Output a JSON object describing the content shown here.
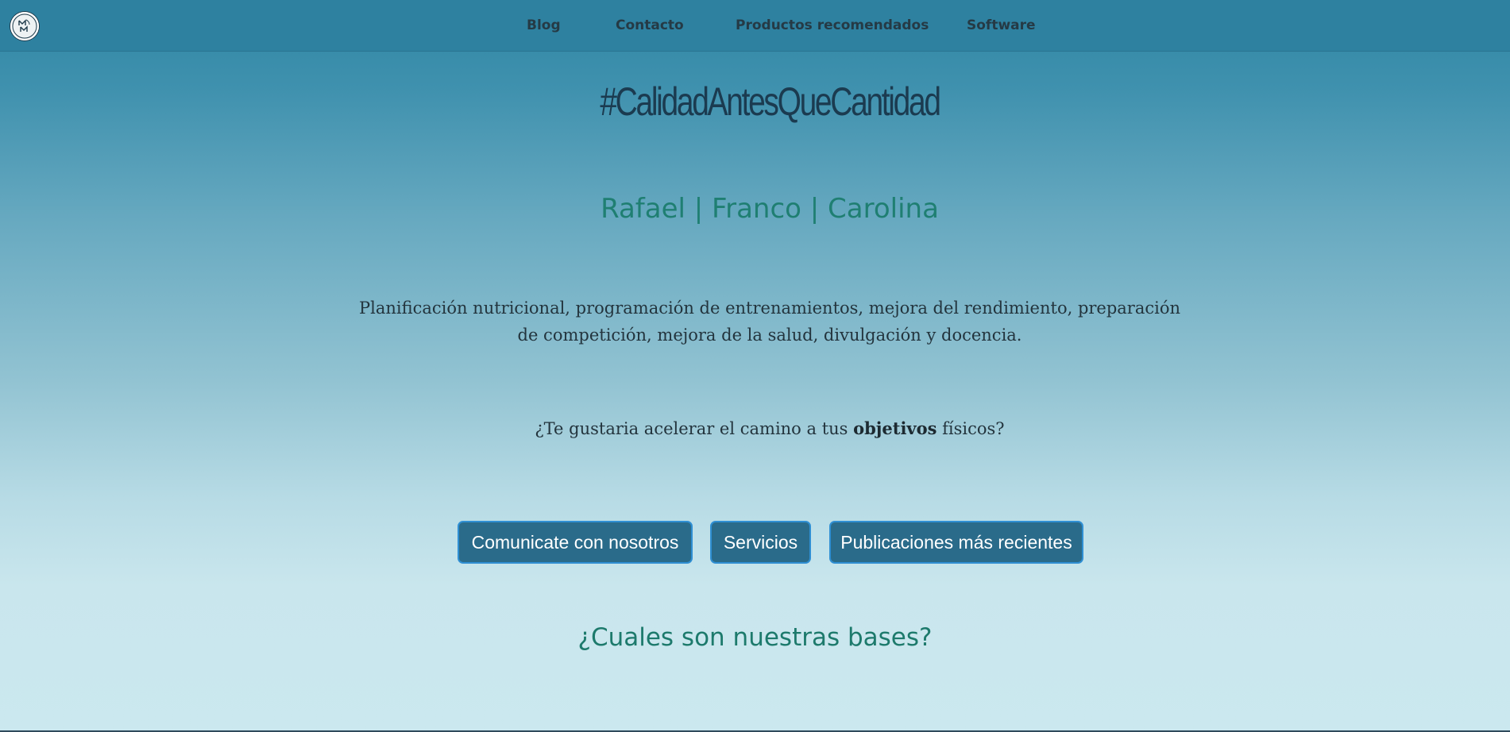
{
  "nav": {
    "logo_alt": "logo-icon",
    "links": [
      {
        "label": "Blog"
      },
      {
        "label": "Contacto"
      },
      {
        "label": "Productos recomendados"
      },
      {
        "label": "Software"
      }
    ]
  },
  "hero": {
    "title": "#CalidadAntesQueCantidad",
    "team": "Rafael | Franco | Carolina",
    "description": "Planificación nutricional, programación de entrenamientos, mejora del rendimiento, preparación de competición, mejora de la salud, divulgación y docencia.",
    "question_prefix": "¿Te gustaria acelerar el camino a tus ",
    "question_bold": "objetivos",
    "question_suffix": " físicos?"
  },
  "actions": {
    "contact_label": "Comunicate con nosotros",
    "services_label": "Servicios",
    "publications_label": "Publicaciones más recientes"
  },
  "sections": {
    "bases_heading": "¿Cuales son nuestras bases?"
  },
  "colors": {
    "navbar": "#2e81a0",
    "title": "#1b3b50",
    "accent_teal": "#1f7f72",
    "button_bg": "#2a6b8a",
    "button_border": "#2f8fd3"
  }
}
